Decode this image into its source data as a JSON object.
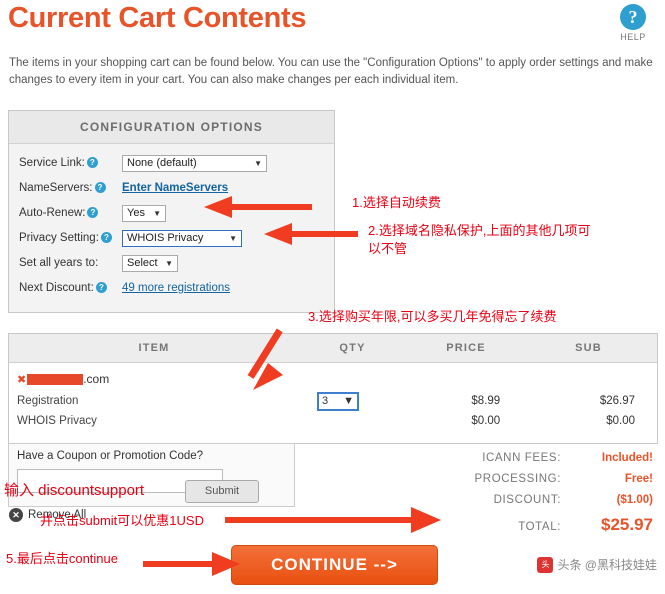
{
  "header": {
    "title": "Current Cart Contents",
    "help_icon": "question-mark-icon",
    "help_label": "HELP",
    "intro": "The items in your shopping cart can be found below. You can use the \"Configuration Options\" to apply order settings and make changes to every item in your cart. You can also make changes per each individual item."
  },
  "config": {
    "heading": "CONFIGURATION OPTIONS",
    "rows": [
      {
        "label": "Service Link:",
        "control": "select",
        "value": "None (default)"
      },
      {
        "label": "NameServers:",
        "control": "link",
        "value": "Enter NameServers"
      },
      {
        "label": "Auto-Renew:",
        "control": "select",
        "value": "Yes"
      },
      {
        "label": "Privacy Setting:",
        "control": "select",
        "value": "WHOIS Privacy"
      },
      {
        "label": "Set all years to:",
        "control": "select",
        "value": "Select"
      },
      {
        "label": "Next Discount:",
        "control": "link",
        "value": "49 more registrations"
      }
    ]
  },
  "cart": {
    "columns": [
      "ITEM",
      "QTY",
      "PRICE",
      "SUB"
    ],
    "domain": ".com",
    "lines": [
      {
        "item": "Registration",
        "qty": "3",
        "price": "$8.99",
        "sub": "$26.97"
      },
      {
        "item": "WHOIS Privacy",
        "qty": "",
        "price": "$0.00",
        "sub": "$0.00"
      }
    ]
  },
  "coupon": {
    "label": "Have a Coupon or Promotion Code?",
    "value": "",
    "placeholder": "",
    "submit_label": "Submit"
  },
  "totals": [
    {
      "label": "ICANN FEES:",
      "value": "Included!"
    },
    {
      "label": "PROCESSING:",
      "value": "Free!"
    },
    {
      "label": "DISCOUNT:",
      "value": "($1.00)"
    },
    {
      "label": "TOTAL:",
      "value": "$25.97"
    }
  ],
  "actions": {
    "remove_all": "Remove All",
    "continue": "CONTINUE -->"
  },
  "annotations": [
    {
      "id": "a1",
      "text": "1.选择自动续费"
    },
    {
      "id": "a2",
      "text": "2.选择域名隐私保护,上面的其他几项可\n以不管"
    },
    {
      "id": "a3",
      "text": "3.选择购买年限,可以多买几年免得忘了续费"
    },
    {
      "id": "a4",
      "text": "输入 discountsupport"
    },
    {
      "id": "a5",
      "text": "并点击submit可以优惠1USD"
    },
    {
      "id": "a6",
      "text": "5.最后点击continue"
    }
  ],
  "watermark": "头条 @黑科技娃娃"
}
